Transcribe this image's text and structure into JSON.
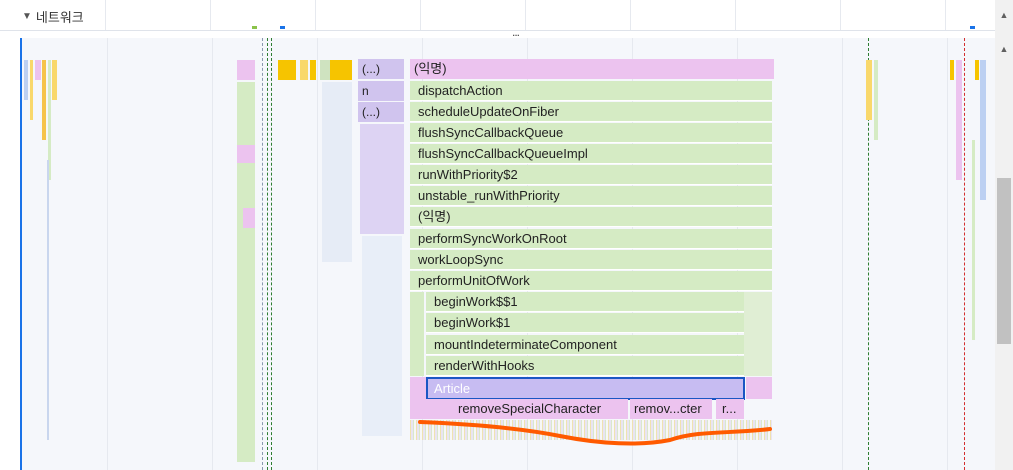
{
  "track": {
    "name": "네트워크",
    "expand_icon": "triangle-down-icon"
  },
  "more_indicator": "...",
  "flame": {
    "left_labels": [
      "(...)",
      "n",
      "(...)"
    ],
    "stack": [
      "(익명)",
      "dispatchAction",
      "scheduleUpdateOnFiber",
      "flushSyncCallbackQueue",
      "flushSyncCallbackQueueImpl",
      "runWithPriority$2",
      "unstable_runWithPriority",
      "(익명)",
      "performSyncWorkOnRoot",
      "workLoopSync",
      "performUnitOfWork",
      "beginWork$$1",
      "beginWork$1",
      "mountIndeterminateComponent",
      "renderWithHooks",
      "Article"
    ],
    "bottom": [
      "removeSpecialCharacter",
      "remov...cter",
      "r..."
    ]
  },
  "colors": {
    "selection_border": "#1a56c4",
    "annotation_stroke": "#ff5a00",
    "accent": "#1a73e8"
  }
}
